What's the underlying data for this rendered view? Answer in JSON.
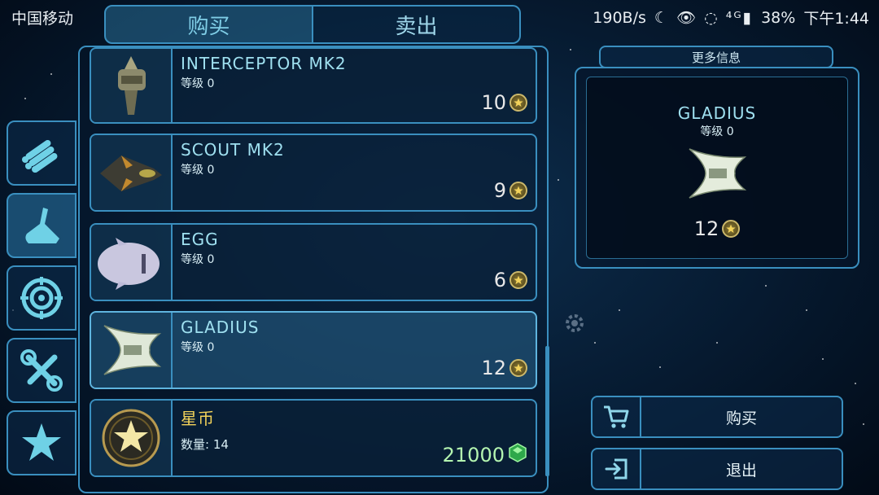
{
  "status_bar": {
    "carrier": "中国移动",
    "speed": "190B/s",
    "battery": "38%",
    "time": "下午1:44",
    "icons": "☾ 👁 ◌ ⁴ᴳ▮"
  },
  "tabs": [
    {
      "label": "购买",
      "active": true
    },
    {
      "label": "卖出",
      "active": false
    }
  ],
  "sidebar": [
    {
      "icon": "missiles-icon",
      "active": false
    },
    {
      "icon": "wing-icon",
      "active": true
    },
    {
      "icon": "target-icon",
      "active": false
    },
    {
      "icon": "tools-icon",
      "active": false
    },
    {
      "icon": "star-icon",
      "active": false
    }
  ],
  "items": [
    {
      "name": "INTERCEPTOR MK2",
      "level": "等级 0",
      "price": "10",
      "currency": "star"
    },
    {
      "name": "SCOUT MK2",
      "level": "等级 0",
      "price": "9",
      "currency": "star"
    },
    {
      "name": "EGG",
      "level": "等级 0",
      "price": "6",
      "currency": "star"
    },
    {
      "name": "GLADIUS",
      "level": "等级 0",
      "price": "12",
      "currency": "star",
      "selected": true
    },
    {
      "name": "星币",
      "level": "数量: 14",
      "price": "21000",
      "currency": "cube"
    }
  ],
  "detail": {
    "more_info_label": "更多信息",
    "name": "GLADIUS",
    "level": "等级 0",
    "price": "12"
  },
  "actions": {
    "buy_label": "购买",
    "exit_label": "退出"
  },
  "colors": {
    "accent": "#3a8fbf",
    "title_text": "#9fe0f0",
    "gold": "#f3d35a",
    "currency_green": "#b4f5b0"
  }
}
